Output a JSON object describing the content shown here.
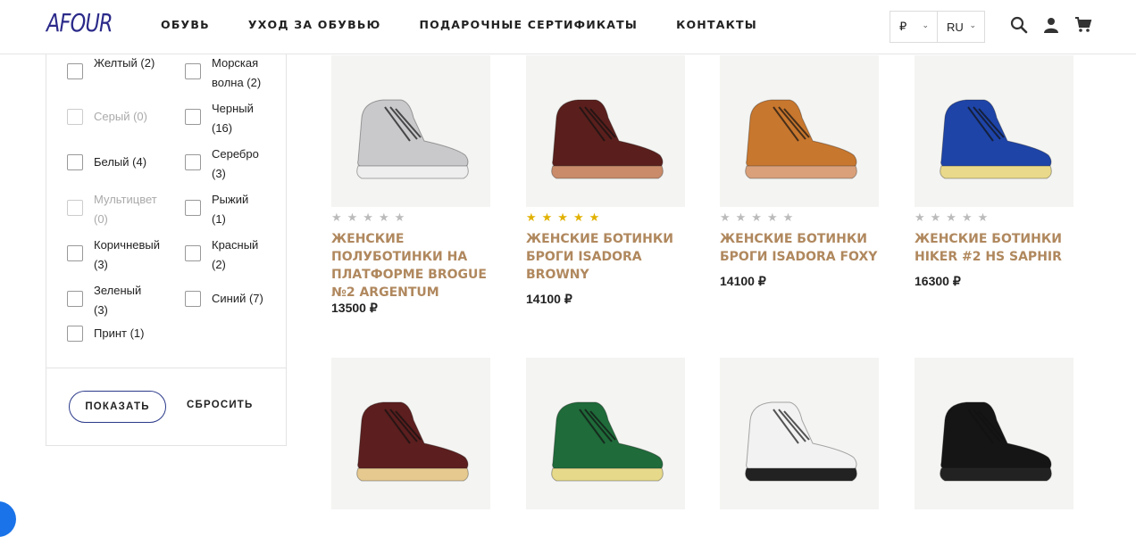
{
  "header": {
    "logo": "AFOUR",
    "nav": [
      "ОБУВЬ",
      "УХОД ЗА ОБУВЬЮ",
      "ПОДАРОЧНЫЕ СЕРТИФИКАТЫ",
      "КОНТАКТЫ"
    ],
    "currency": "₽",
    "language": "RU",
    "icons": [
      "search-icon",
      "user-icon",
      "cart-icon"
    ]
  },
  "filter": {
    "options": [
      {
        "label": "Желтый (2)",
        "disabled": false
      },
      {
        "label": "Морская волна (2)",
        "disabled": false
      },
      {
        "label": "Серый (0)",
        "disabled": true
      },
      {
        "label": "Черный (16)",
        "disabled": false
      },
      {
        "label": "Белый (4)",
        "disabled": false
      },
      {
        "label": "Серебро (3)",
        "disabled": false
      },
      {
        "label": "Мультицвет (0)",
        "disabled": true
      },
      {
        "label": "Рыжий (1)",
        "disabled": false
      },
      {
        "label": "Коричневый (3)",
        "disabled": false
      },
      {
        "label": "Красный (2)",
        "disabled": false
      },
      {
        "label": "Зеленый (3)",
        "disabled": false
      },
      {
        "label": "Синий (7)",
        "disabled": false
      },
      {
        "label": "Принт (1)",
        "disabled": false
      }
    ],
    "show_button": "ПОКАЗАТЬ",
    "reset_button": "СБРОСИТЬ"
  },
  "products": [
    {
      "title": "ЖЕНСКИЕ ПОЛУБОТИНКИ НА ПЛАТФОРМЕ BROGUE №2 ARGENTUM",
      "price": "13500 ₽",
      "rating": 0,
      "color": "#c9c9cc",
      "sole": "#eeeeee"
    },
    {
      "title": "ЖЕНСКИЕ БОТИНКИ БРОГИ ISADORA BROWNY",
      "price": "14100 ₽",
      "rating": 5,
      "color": "#5a1f1c",
      "sole": "#c98b6a"
    },
    {
      "title": "ЖЕНСКИЕ БОТИНКИ БРОГИ ISADORA FOXY",
      "price": "14100 ₽",
      "rating": 0,
      "color": "#c8772e",
      "sole": "#d9a07a"
    },
    {
      "title": "ЖЕНСКИЕ БОТИНКИ HIKER #2 HS SAPHIR",
      "price": "16300 ₽",
      "rating": 0,
      "color": "#1e44a8",
      "sole": "#e9d98a"
    },
    {
      "color": "#5c1e1e",
      "sole": "#e6c98f"
    },
    {
      "color": "#1f6b3a",
      "sole": "#e6d98a"
    },
    {
      "color": "#f2f2f2",
      "sole": "#222222"
    },
    {
      "color": "#151515",
      "sole": "#222222"
    }
  ]
}
